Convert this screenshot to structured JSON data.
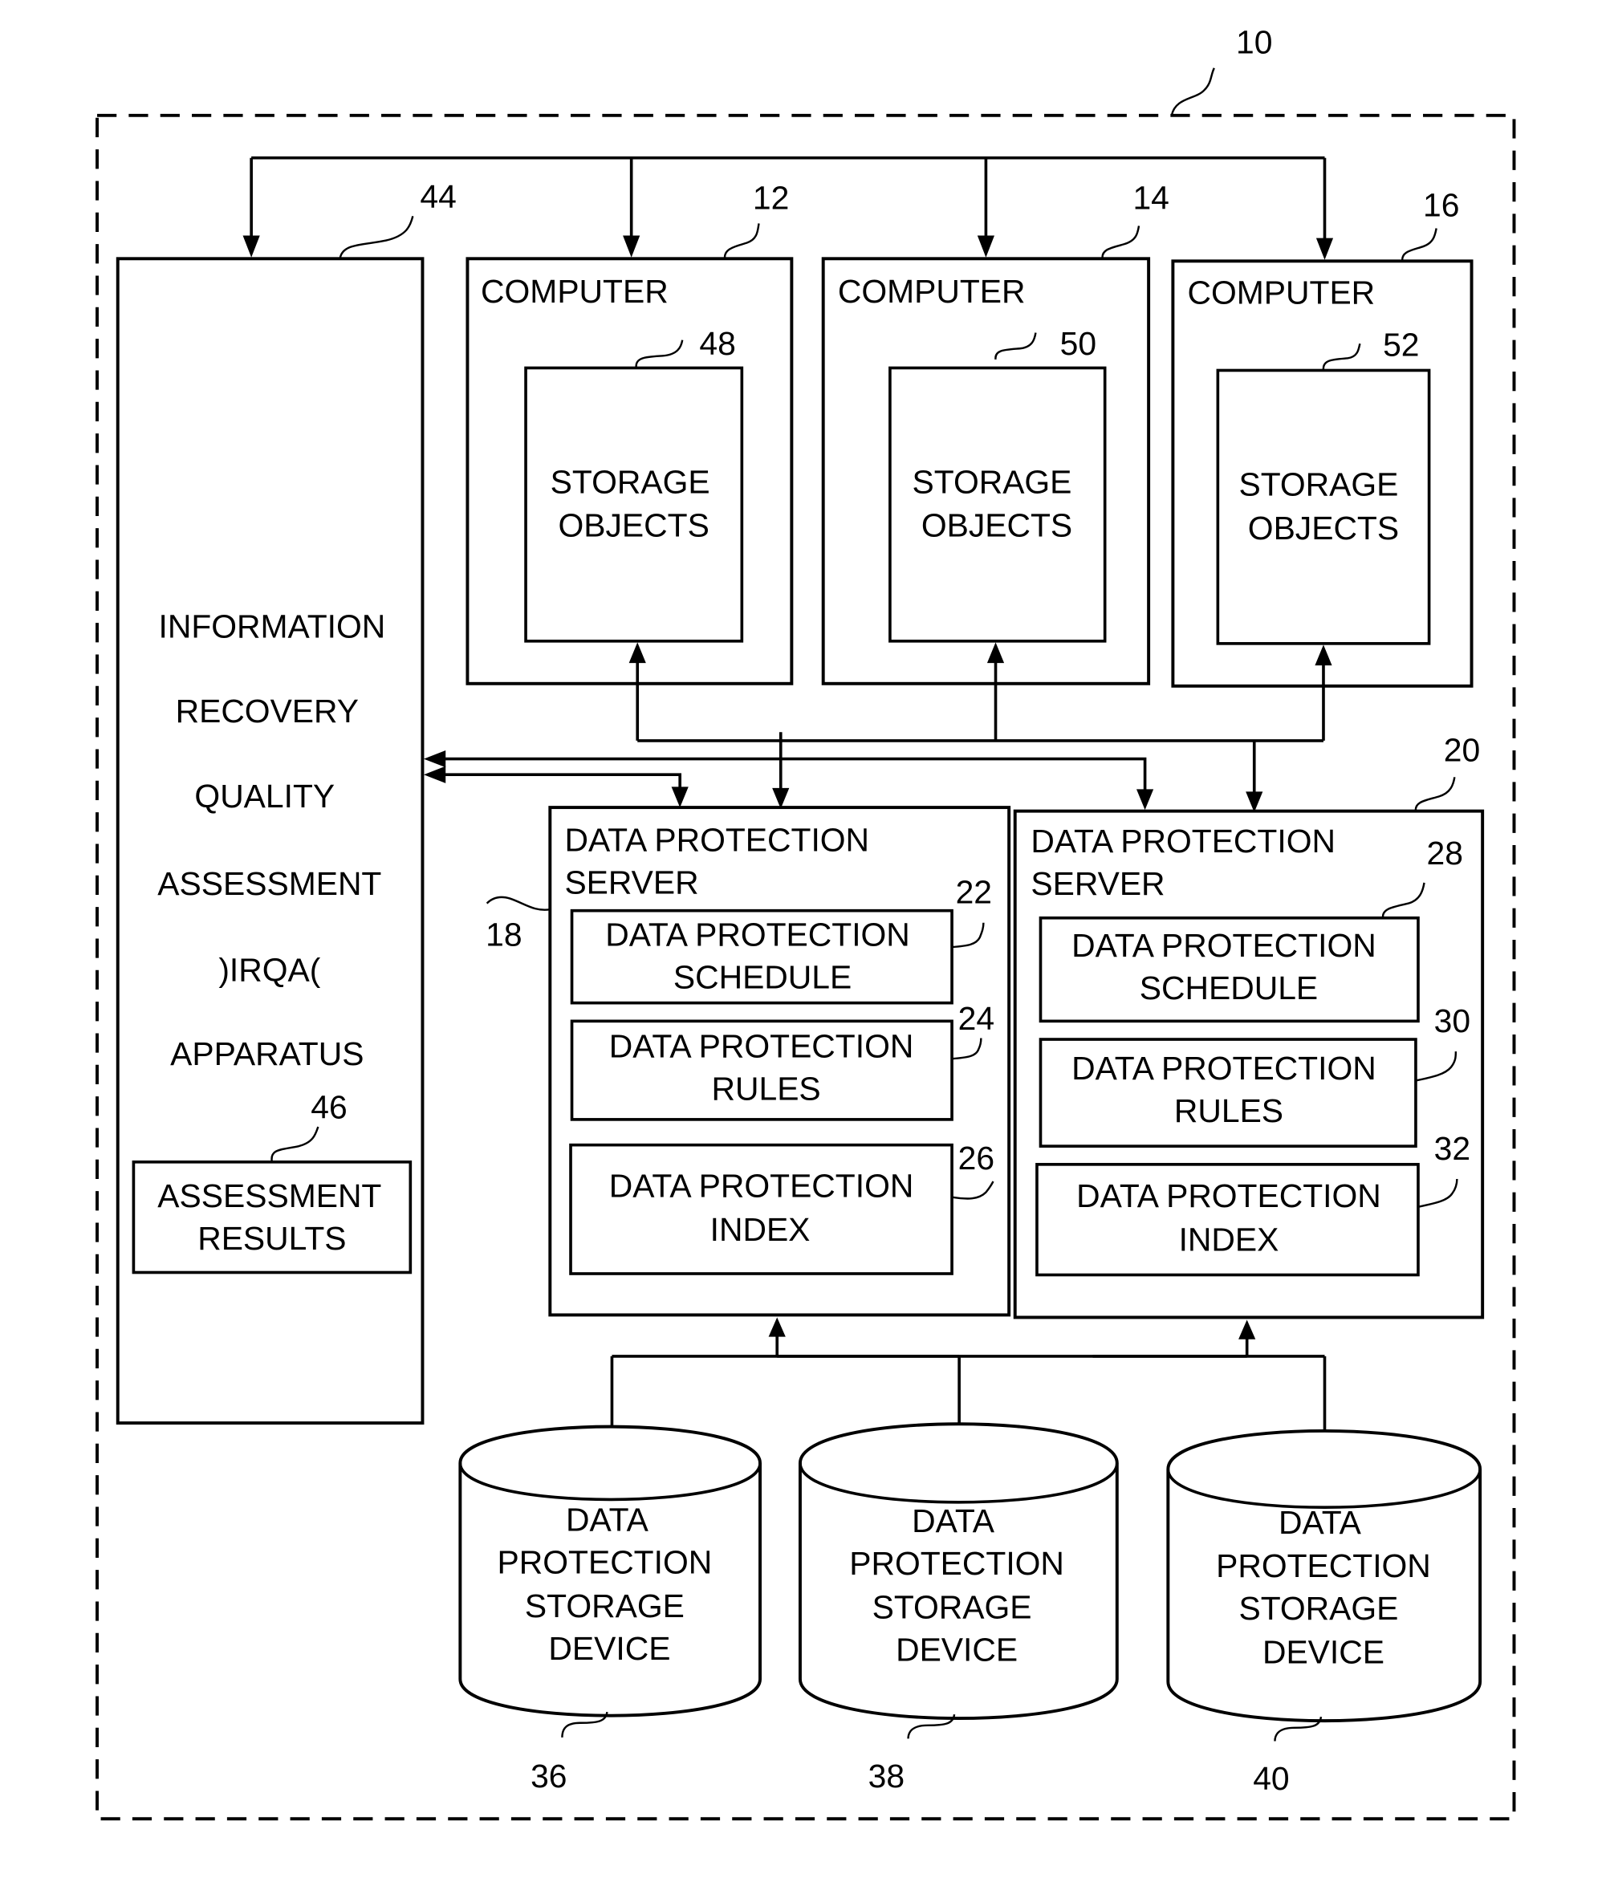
{
  "figure": {
    "system": {
      "ref": "10"
    },
    "irqa": {
      "ref": "44",
      "lines": [
        "INFORMATION",
        "RECOVERY",
        "QUALITY",
        "ASSESSMENT",
        ")IRQA(",
        "APPARATUS"
      ],
      "results": {
        "ref": "46",
        "lines": [
          "ASSESSMENT",
          "RESULTS"
        ]
      }
    },
    "computers": [
      {
        "ref": "12",
        "label": "COMPUTER",
        "storage": {
          "ref": "48",
          "lines": [
            "STORAGE",
            "OBJECTS"
          ]
        }
      },
      {
        "ref": "14",
        "label": "COMPUTER",
        "storage": {
          "ref": "50",
          "lines": [
            "STORAGE",
            "OBJECTS"
          ]
        }
      },
      {
        "ref": "16",
        "label": "COMPUTER",
        "storage": {
          "ref": "52",
          "lines": [
            "STORAGE",
            "OBJECTS"
          ]
        }
      }
    ],
    "servers": [
      {
        "ref": "18",
        "lines": [
          "DATA PROTECTION",
          "SERVER"
        ],
        "components": [
          {
            "ref": "22",
            "lines": [
              "DATA PROTECTION",
              "SCHEDULE"
            ]
          },
          {
            "ref": "24",
            "lines": [
              "DATA PROTECTION",
              "RULES"
            ]
          },
          {
            "ref": "26",
            "lines": [
              "DATA PROTECTION",
              "INDEX"
            ]
          }
        ]
      },
      {
        "ref": "20",
        "lines": [
          "DATA PROTECTION",
          "SERVER"
        ],
        "components": [
          {
            "ref": "28",
            "lines": [
              "DATA PROTECTION",
              "SCHEDULE"
            ]
          },
          {
            "ref": "30",
            "lines": [
              "DATA PROTECTION",
              "RULES"
            ]
          },
          {
            "ref": "32",
            "lines": [
              "DATA PROTECTION",
              "INDEX"
            ]
          }
        ]
      }
    ],
    "storage_devices": [
      {
        "ref": "36",
        "lines": [
          "DATA",
          "PROTECTION",
          "STORAGE",
          "DEVICE"
        ]
      },
      {
        "ref": "38",
        "lines": [
          "DATA",
          "PROTECTION",
          "STORAGE",
          "DEVICE"
        ]
      },
      {
        "ref": "40",
        "lines": [
          "DATA",
          "PROTECTION",
          "STORAGE",
          "DEVICE"
        ]
      }
    ]
  }
}
